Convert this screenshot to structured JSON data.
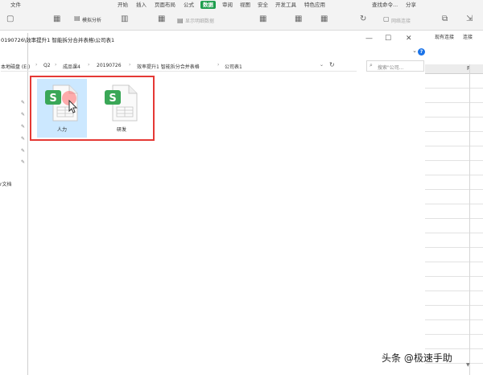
{
  "ribbon": {
    "menu": [
      "文件",
      "开始",
      "插入",
      "页面布局",
      "公式",
      "数据",
      "审阅",
      "视图",
      "安全",
      "开发工具",
      "特色应用",
      "查找命令...",
      "分享"
    ],
    "active_tab": "数据",
    "tools": {
      "simulate_analysis": "模拟分析",
      "notice_connection": "网络连接",
      "compare_data": "显示明细数据",
      "existing_connection": "现有连接",
      "connect": "连接"
    }
  },
  "explorer": {
    "title": "0190726\\效率提升1 智能拆分合并表格\\公司表1",
    "address": [
      "本地磁盘 (E:)",
      "Q2",
      "成品课4",
      "20190726",
      "效率提升1 智能拆分合并表格",
      "公司表1"
    ],
    "search_placeholder": "搜索\"公司...",
    "nav_doc_label": "r文档",
    "files": [
      {
        "label": "人力",
        "selected": true
      },
      {
        "label": "研发",
        "selected": false
      }
    ],
    "help": "?"
  },
  "sheet": {
    "column_label": "F"
  },
  "watermark": "头条 @极速手助",
  "colors": {
    "accent_green": "#1f9e4e",
    "highlight_red": "#e53935",
    "selection_blue": "#cce8ff"
  }
}
